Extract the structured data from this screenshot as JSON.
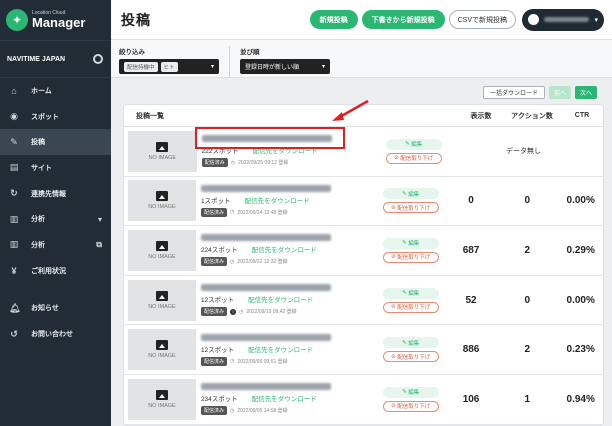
{
  "brand": {
    "sub": "Location Cloud",
    "main": "Manager"
  },
  "org": {
    "name": "NAVITIME JAPAN"
  },
  "nav": [
    {
      "label": "ホーム",
      "icon": "home-icon",
      "glyph": "⌂"
    },
    {
      "label": "スポット",
      "icon": "pin-icon",
      "glyph": "◉"
    },
    {
      "label": "投稿",
      "icon": "post-icon",
      "glyph": "✎",
      "active": true
    },
    {
      "label": "サイト",
      "icon": "site-icon",
      "glyph": "▤"
    },
    {
      "label": "連携先情報",
      "icon": "sync-icon",
      "glyph": "↻"
    },
    {
      "label": "分析",
      "icon": "analytics-icon",
      "glyph": "▥",
      "trail": "▾"
    },
    {
      "label": "分析",
      "icon": "analytics-external-icon",
      "glyph": "▥",
      "trail": "⧉"
    },
    {
      "label": "ご利用状況",
      "icon": "yen-icon",
      "glyph": "¥"
    },
    {
      "label": "お知らせ",
      "icon": "bell-icon",
      "glyph": "🔔︎"
    },
    {
      "label": "お問い合わせ",
      "icon": "contact-icon",
      "glyph": "↺"
    }
  ],
  "header": {
    "title": "投稿",
    "new_post": "新規投稿",
    "new_from_draft": "下書きから新規投稿",
    "csv_new": "CSVで新規投稿"
  },
  "filters": {
    "filter_label": "絞り込み",
    "filter_chip1": "配信持機中",
    "filter_chip2": "ヒト",
    "sort_label": "並び順",
    "sort_value": "登録日時が新しい順"
  },
  "list_actions": {
    "bulk_download": "一括ダウンロード",
    "prev": "前へ",
    "next": "次へ"
  },
  "table": {
    "headers": {
      "title": "投稿一覧",
      "views": "表示数",
      "actions": "アクション数",
      "ctr": "CTR"
    },
    "no_image": "NO IMAGE",
    "edit": "編集",
    "pull": "配信取り下げ",
    "download": "配信先をダウンロード",
    "no_data": "データ無し",
    "rows": [
      {
        "spots": "222スポット",
        "status": "配信済み",
        "date": "2022/09/25 09:12 登録",
        "views": "",
        "actions": "",
        "ctr": "",
        "nodata": true
      },
      {
        "spots": "1スポット",
        "status": "配信済み",
        "date": "2022/09/24 13:48 登録",
        "views": "0",
        "actions": "0",
        "ctr": "0.00%"
      },
      {
        "spots": "224スポット",
        "status": "配信済み",
        "date": "2022/09/22 12:32 登録",
        "views": "687",
        "actions": "2",
        "ctr": "0.29%"
      },
      {
        "spots": "12スポット",
        "status": "配信済み",
        "date": "2022/09/19 09:42 登録",
        "views": "52",
        "actions": "0",
        "ctr": "0.00%",
        "info": true
      },
      {
        "spots": "12スポット",
        "status": "配信済み",
        "date": "2022/09/09 09:51 登録",
        "views": "886",
        "actions": "2",
        "ctr": "0.23%"
      },
      {
        "spots": "234スポット",
        "status": "配信済み",
        "date": "2022/09/05 14:58 登録",
        "views": "106",
        "actions": "1",
        "ctr": "0.94%"
      }
    ]
  },
  "colors": {
    "accent": "#2bb673",
    "sidebar": "#212c36",
    "annotation": "#e02020"
  }
}
